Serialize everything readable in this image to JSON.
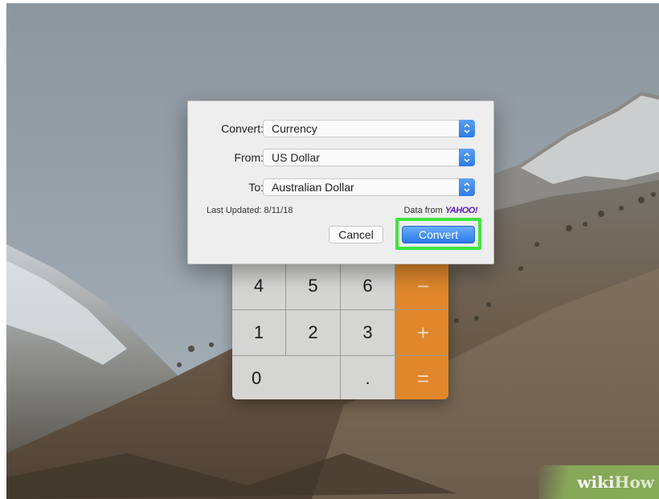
{
  "dialog": {
    "convert_label": "Convert:",
    "convert_value": "Currency",
    "from_label": "From:",
    "from_value": "US Dollar",
    "to_label": "To:",
    "to_value": "Australian Dollar",
    "last_updated": "Last Updated: 8/11/18",
    "data_from": "Data from",
    "yahoo": "YAHOO!",
    "cancel_label": "Cancel",
    "convert_button_label": "Convert",
    "highlight_color": "#3fe43f"
  },
  "keypad": {
    "row1": [
      "4",
      "5",
      "6",
      "−"
    ],
    "row2": [
      "1",
      "2",
      "3",
      "+"
    ],
    "row3": [
      "0",
      ".",
      "="
    ],
    "operator_color": "#e0872c"
  },
  "watermark": {
    "wiki": "wiki",
    "how": "How"
  }
}
